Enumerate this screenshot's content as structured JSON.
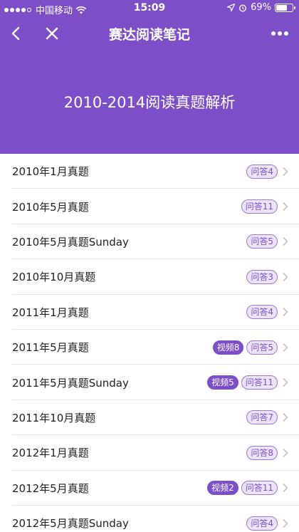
{
  "status": {
    "carrier": "中国移动",
    "time": "15:09",
    "battery": "69%",
    "battery_level": 0.69
  },
  "nav": {
    "title": "赛达阅读笔记"
  },
  "banner": {
    "title": "2010-2014阅读真题解析"
  },
  "items": [
    {
      "title": "2010年1月真题",
      "video": "",
      "qa": "问答4"
    },
    {
      "title": "2010年5月真题",
      "video": "",
      "qa": "问答11"
    },
    {
      "title": "2010年5月真题Sunday",
      "video": "",
      "qa": "问答5"
    },
    {
      "title": "2010年10月真题",
      "video": "",
      "qa": "问答3"
    },
    {
      "title": "2011年1月真题",
      "video": "",
      "qa": "问答4"
    },
    {
      "title": "2011年5月真题",
      "video": "视频8",
      "qa": "问答5"
    },
    {
      "title": "2011年5月真题Sunday",
      "video": "视频5",
      "qa": "问答11"
    },
    {
      "title": "2011年10月真题",
      "video": "",
      "qa": "问答7"
    },
    {
      "title": "2012年1月真题",
      "video": "",
      "qa": "问答8"
    },
    {
      "title": "2012年5月真题",
      "video": "视频2",
      "qa": "问答11"
    },
    {
      "title": "2012年5月真题Sunday",
      "video": "",
      "qa": "问答4"
    }
  ],
  "colors": {
    "accent": "#7c4fc8"
  }
}
